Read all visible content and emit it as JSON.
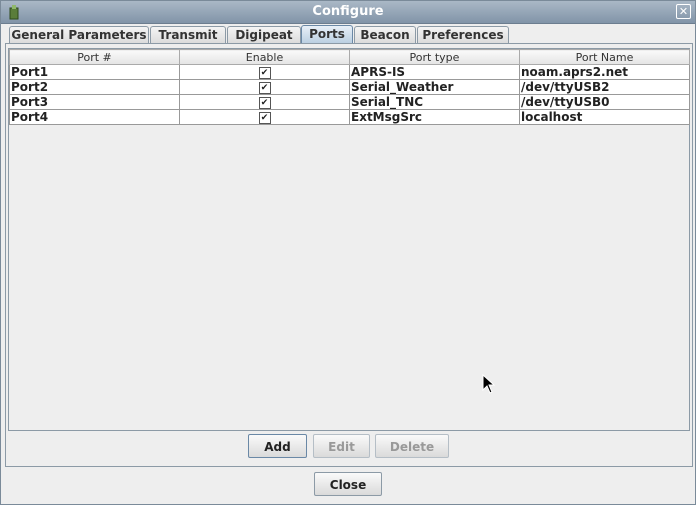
{
  "window": {
    "title": "Configure"
  },
  "tabs": [
    {
      "label": "General Parameters"
    },
    {
      "label": "Transmit"
    },
    {
      "label": "Digipeat"
    },
    {
      "label": "Ports"
    },
    {
      "label": "Beacon"
    },
    {
      "label": "Preferences"
    }
  ],
  "active_tab": "Ports",
  "table": {
    "columns": [
      "Port #",
      "Enable",
      "Port type",
      "Port Name"
    ],
    "rows": [
      {
        "port": "Port1",
        "enabled": true,
        "check": "✔",
        "type": "APRS-IS",
        "name": "noam.aprs2.net"
      },
      {
        "port": "Port2",
        "enabled": true,
        "check": "✔",
        "type": "Serial_Weather",
        "name": "/dev/ttyUSB2"
      },
      {
        "port": "Port3",
        "enabled": true,
        "check": "✔",
        "type": "Serial_TNC",
        "name": "/dev/ttyUSB0"
      },
      {
        "port": "Port4",
        "enabled": true,
        "check": "✔",
        "type": "ExtMsgSrc",
        "name": "localhost"
      }
    ]
  },
  "buttons": {
    "add": "Add",
    "edit": "Edit",
    "delete": "Delete",
    "close": "Close"
  },
  "icons": {
    "window_close": "✕"
  }
}
